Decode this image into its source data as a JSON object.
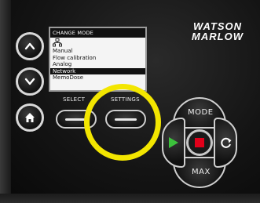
{
  "device": {
    "logo_line1": "WATSON",
    "logo_line2": "MARLOW"
  },
  "screen": {
    "title": "CHANGE MODE",
    "icon": "network-tree-icon",
    "menu_items": [
      {
        "label": "Manual",
        "selected": false
      },
      {
        "label": "Flow calibration",
        "selected": false
      },
      {
        "label": "Analog",
        "selected": false
      },
      {
        "label": "Network",
        "selected": true
      },
      {
        "label": "MemoDose",
        "selected": false
      }
    ]
  },
  "softkeys": {
    "left_label": "SELECT",
    "right_label": "SETTINGS"
  },
  "buttons": {
    "up_icon": "chevron-up-icon",
    "down_icon": "chevron-down-icon",
    "home_icon": "home-icon",
    "mode_label": "MODE",
    "max_label": "MAX",
    "start_icon": "play-icon",
    "stop_icon": "stop-icon",
    "direction_icon": "rotate-icon"
  },
  "colors": {
    "highlight": "#f3e600",
    "start_green": "#3cc23c",
    "stop_red": "#e2001a",
    "selected_row": "#111111"
  }
}
